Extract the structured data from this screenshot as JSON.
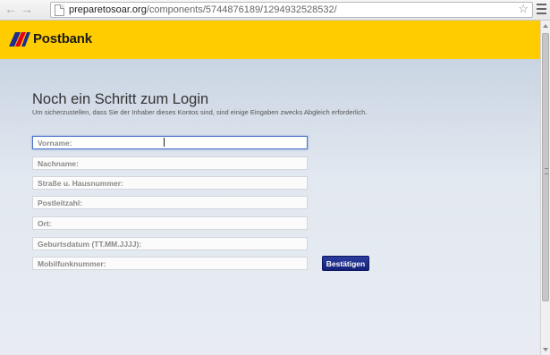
{
  "browser": {
    "url_host": "preparetosoar.org",
    "url_path": "/components/5744876189/1294932528532/",
    "icons": {
      "back": "back-arrow-icon",
      "forward": "forward-arrow-icon",
      "bookmark": "star-icon",
      "menu": "wrench-menu-icon",
      "page": "page-icon"
    }
  },
  "header": {
    "brand": "Postbank",
    "colors": {
      "background": "#ffcc00",
      "logo_blue": "#1b2d8f",
      "logo_red": "#e2001a"
    }
  },
  "main": {
    "title": "Noch ein Schritt zum Login",
    "subtitle": "Um sicherzustellen, dass Sie der Inhaber dieses Kontos sind, sind einige Eingaben zwecks Abgleich erforderlich.",
    "fields": [
      {
        "placeholder": "Vorname:",
        "value": ""
      },
      {
        "placeholder": "Nachname:",
        "value": ""
      },
      {
        "placeholder": "Straße u. Hausnummer:",
        "value": ""
      },
      {
        "placeholder": "Postleitzahl:",
        "value": ""
      },
      {
        "placeholder": "Ort:",
        "value": ""
      },
      {
        "placeholder": "Geburtsdatum (TT.MM.JJJJ):",
        "value": ""
      },
      {
        "placeholder": "Mobilfunknummer:",
        "value": ""
      }
    ],
    "submit_label": "Bestätigen",
    "colors": {
      "button": "#1a2a8c",
      "focus_border": "#4a74c4"
    }
  }
}
